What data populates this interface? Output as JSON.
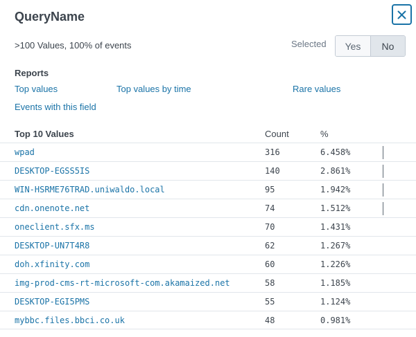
{
  "field": {
    "title": "QueryName",
    "summary": ">100 Values, 100% of events"
  },
  "selected": {
    "label": "Selected",
    "options": [
      "Yes",
      "No"
    ],
    "active": "No"
  },
  "reports": {
    "heading": "Reports",
    "links": {
      "top_values": "Top values",
      "top_values_by_time": "Top values by time",
      "rare_values": "Rare values",
      "events_with_field": "Events with this field"
    }
  },
  "top_values": {
    "heading": "Top 10 Values",
    "count_header": "Count",
    "pct_header": "%",
    "rows": [
      {
        "value": "wpad",
        "count": "316",
        "pct": "6.458%",
        "frac": 0.06458
      },
      {
        "value": "DESKTOP-EGSS5IS",
        "count": "140",
        "pct": "2.861%",
        "frac": 0.02861
      },
      {
        "value": "WIN-HSRME76TRAD.uniwaldo.local",
        "count": "95",
        "pct": "1.942%",
        "frac": 0.01942
      },
      {
        "value": "cdn.onenote.net",
        "count": "74",
        "pct": "1.512%",
        "frac": 0.01512
      },
      {
        "value": "oneclient.sfx.ms",
        "count": "70",
        "pct": "1.431%",
        "frac": 0.01431
      },
      {
        "value": "DESKTOP-UN7T4R8",
        "count": "62",
        "pct": "1.267%",
        "frac": 0.01267
      },
      {
        "value": "doh.xfinity.com",
        "count": "60",
        "pct": "1.226%",
        "frac": 0.01226
      },
      {
        "value": "img-prod-cms-rt-microsoft-com.akamaized.net",
        "count": "58",
        "pct": "1.185%",
        "frac": 0.01185
      },
      {
        "value": "DESKTOP-EGI5PMS",
        "count": "55",
        "pct": "1.124%",
        "frac": 0.01124
      },
      {
        "value": "mybbc.files.bbci.co.uk",
        "count": "48",
        "pct": "0.981%",
        "frac": 0.00981
      }
    ]
  },
  "colors": {
    "link": "#1a73a7",
    "text": "#3c444d",
    "bar": "#5c6773"
  }
}
